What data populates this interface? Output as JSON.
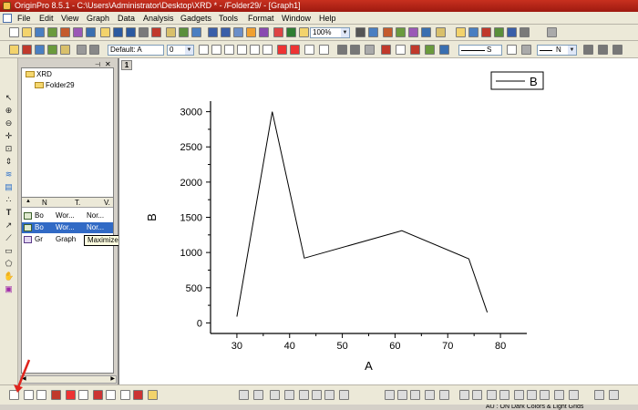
{
  "window": {
    "title": "OriginPro 8.5.1 - C:\\Users\\Administrator\\Desktop\\XRD * - /Folder29/ - [Graph1]"
  },
  "menubar": {
    "items": [
      "File",
      "Edit",
      "View",
      "Graph",
      "Data",
      "Analysis",
      "Gadgets",
      "Tools",
      "Format",
      "Window",
      "Help"
    ]
  },
  "toolbar": {
    "zoom": "100%",
    "font": "Default: A",
    "font_size": "0",
    "line_style": "S",
    "pattern": "N"
  },
  "explorer": {
    "tree": [
      {
        "label": "XRD"
      },
      {
        "label": "Folder29"
      }
    ],
    "columns": [
      "N",
      "T.",
      "V."
    ],
    "rows": [
      {
        "name": "Bo",
        "type": "Wor...",
        "view": "Nor...",
        "selected": false
      },
      {
        "name": "Bo",
        "type": "Wor...",
        "view": "Nor...",
        "selected": true
      },
      {
        "name": "Gr",
        "type": "Graph",
        "view": "",
        "selected": false
      }
    ],
    "tooltip": "Maximized"
  },
  "graph": {
    "tab_label": "1"
  },
  "chart_data": {
    "type": "line",
    "xlabel": "A",
    "ylabel": "B",
    "xlim": [
      25,
      85
    ],
    "ylim": [
      -150,
      3150
    ],
    "xticks": [
      30,
      40,
      50,
      60,
      70,
      80
    ],
    "yticks": [
      0,
      500,
      1000,
      1500,
      2000,
      2500,
      3000
    ],
    "series": [
      {
        "name": "B",
        "x": [
          30,
          36.7,
          42.8,
          61.3,
          74,
          77.5
        ],
        "y": [
          90,
          3000,
          920,
          1310,
          910,
          150
        ]
      }
    ],
    "legend": {
      "position": "top-right",
      "entries": [
        "B"
      ]
    },
    "grid": false
  },
  "statusbar": {
    "text": "AU : ON   Dark Colors & Light Grids"
  }
}
